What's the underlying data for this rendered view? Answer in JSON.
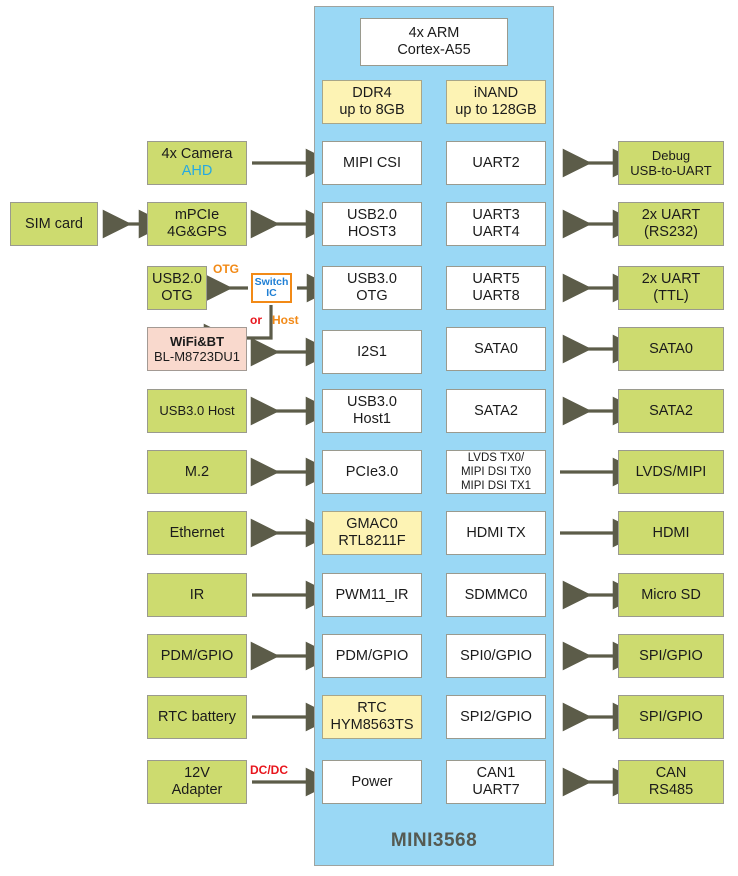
{
  "soc": {
    "name": "MINI3568",
    "cpu": {
      "line1": "4x ARM",
      "line2": "Cortex-A55"
    },
    "memory": [
      {
        "line1": "DDR4",
        "line2": "up to 8GB"
      },
      {
        "line1": "iNAND",
        "line2": "up to 128GB"
      }
    ],
    "left_column": [
      {
        "line1": "MIPI CSI",
        "line2": ""
      },
      {
        "line1": "USB2.0",
        "line2": "HOST3"
      },
      {
        "line1": "USB3.0",
        "line2": "OTG"
      },
      {
        "line1": "I2S1",
        "line2": ""
      },
      {
        "line1": "USB3.0",
        "line2": "Host1"
      },
      {
        "line1": "PCIe3.0",
        "line2": ""
      },
      {
        "line1": "GMAC0",
        "line2": "RTL8211F"
      },
      {
        "line1": "PWM11_IR",
        "line2": ""
      },
      {
        "line1": "PDM/GPIO",
        "line2": ""
      },
      {
        "line1": "RTC",
        "line2": "HYM8563TS"
      },
      {
        "line1": "Power",
        "line2": ""
      }
    ],
    "right_column": [
      {
        "line1": "UART2",
        "line2": "",
        "line3": ""
      },
      {
        "line1": "UART3",
        "line2": "UART4",
        "line3": ""
      },
      {
        "line1": "UART5",
        "line2": "UART8",
        "line3": ""
      },
      {
        "line1": "SATA0",
        "line2": "",
        "line3": ""
      },
      {
        "line1": "SATA2",
        "line2": "",
        "line3": ""
      },
      {
        "line1": "LVDS TX0/",
        "line2": "MIPI DSI TX0",
        "line3": "MIPI DSI TX1"
      },
      {
        "line1": "HDMI TX",
        "line2": "",
        "line3": ""
      },
      {
        "line1": "SDMMC0",
        "line2": "",
        "line3": ""
      },
      {
        "line1": "SPI0/GPIO",
        "line2": "",
        "line3": ""
      },
      {
        "line1": "SPI2/GPIO",
        "line2": "",
        "line3": ""
      },
      {
        "line1": "CAN1",
        "line2": "UART7",
        "line3": ""
      }
    ]
  },
  "peripherals_left": [
    {
      "line1": "4x Camera",
      "line2": "AHD"
    },
    {
      "line1": "mPCIe",
      "line2": "4G&GPS"
    },
    {
      "line1": "USB2.0",
      "line2": "OTG"
    },
    {
      "line1": "WiFi&BT",
      "line2": "BL-M8723DU1"
    },
    {
      "line1": "USB3.0 Host",
      "line2": ""
    },
    {
      "line1": "M.2",
      "line2": ""
    },
    {
      "line1": "Ethernet",
      "line2": ""
    },
    {
      "line1": "IR",
      "line2": ""
    },
    {
      "line1": "PDM/GPIO",
      "line2": ""
    },
    {
      "line1": "RTC battery",
      "line2": ""
    },
    {
      "line1": "12V",
      "line2": "Adapter"
    }
  ],
  "peripherals_right": [
    {
      "line1": "Debug",
      "line2": "USB-to-UART"
    },
    {
      "line1": "2x UART",
      "line2": "(RS232)"
    },
    {
      "line1": "2x UART",
      "line2": "(TTL)"
    },
    {
      "line1": "SATA0",
      "line2": ""
    },
    {
      "line1": "SATA2",
      "line2": ""
    },
    {
      "line1": "LVDS/MIPI",
      "line2": ""
    },
    {
      "line1": "HDMI",
      "line2": ""
    },
    {
      "line1": "Micro SD",
      "line2": ""
    },
    {
      "line1": "SPI/GPIO",
      "line2": ""
    },
    {
      "line1": "SPI/GPIO",
      "line2": ""
    },
    {
      "line1": "CAN",
      "line2": "RS485"
    }
  ],
  "sim_card": {
    "label": "SIM card"
  },
  "switch_ic": {
    "line1": "Switch",
    "line2": "IC"
  },
  "annotations": {
    "otg": "OTG",
    "or": "or",
    "host": "Host",
    "dcdc": "DC/DC"
  },
  "colors": {
    "soc_panel": "#9ad8f5",
    "peripheral_green": "#cddb6f",
    "memory_yellow": "#fdf3b4",
    "wifi_pink": "#f9d9cd",
    "arrow": "#5c5c49",
    "accent_orange": "#f28a17",
    "accent_red": "#e8161d",
    "accent_cyan": "#27a9e1",
    "title_gray": "#555a52"
  }
}
